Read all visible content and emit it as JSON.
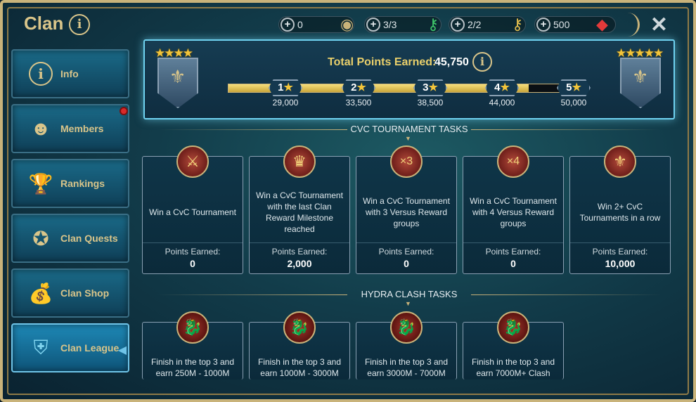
{
  "header": {
    "title": "Clan",
    "info_label": "i",
    "resources": [
      {
        "value": "0",
        "icon": "coin-icon"
      },
      {
        "value": "3/3",
        "icon": "green-key-icon"
      },
      {
        "value": "2/2",
        "icon": "gold-key-icon"
      },
      {
        "value": "500",
        "icon": "ruby-icon"
      }
    ],
    "plus": "+",
    "close": "✕"
  },
  "sidebar": {
    "items": [
      {
        "label": "Info",
        "icon": "i"
      },
      {
        "label": "Members",
        "icon": "☻"
      },
      {
        "label": "Rankings",
        "icon": "🏆"
      },
      {
        "label": "Clan Quests",
        "icon": "✪"
      },
      {
        "label": "Clan Shop",
        "icon": "💰"
      },
      {
        "label": "Clan League",
        "icon": "⛨"
      }
    ]
  },
  "points_panel": {
    "total_label": "Total Points Earned:",
    "total_value": "45,750",
    "progress": 0.84,
    "milestones": [
      {
        "num": "1",
        "points": "29,000"
      },
      {
        "num": "2",
        "points": "33,500"
      },
      {
        "num": "3",
        "points": "38,500"
      },
      {
        "num": "4",
        "points": "44,000"
      },
      {
        "num": "5",
        "points": "50,000"
      }
    ],
    "left_stars": "★★★★",
    "right_stars": "★★★★★"
  },
  "cvc": {
    "title": "CVC TOURNAMENT TASKS",
    "points_label": "Points Earned:",
    "tasks": [
      {
        "text": "Win a CvC Tournament",
        "points": "0",
        "icon": "⚔"
      },
      {
        "text": "Win a CvC Tournament with the last Clan Reward Milestone reached",
        "points": "2,000",
        "icon": "♛"
      },
      {
        "text": "Win a CvC Tournament with 3 Versus Reward groups",
        "points": "0",
        "icon": "×3"
      },
      {
        "text": "Win a CvC Tournament with 4 Versus Reward groups",
        "points": "0",
        "icon": "×4"
      },
      {
        "text": "Win 2+ CvC Tournaments in a row",
        "points": "10,000",
        "icon": "⚜"
      }
    ]
  },
  "hydra": {
    "title": "HYDRA CLASH TASKS",
    "tasks": [
      {
        "text": "Finish in the top 3 and earn 250M - 1000M",
        "icon": "🐉"
      },
      {
        "text": "Finish in the top 3 and earn 1000M - 3000M",
        "icon": "🐉"
      },
      {
        "text": "Finish in the top 3 and earn 3000M - 7000M",
        "icon": "🐉"
      },
      {
        "text": "Finish in the top 3 and earn 7000M+ Clash",
        "icon": "🐉"
      }
    ]
  }
}
